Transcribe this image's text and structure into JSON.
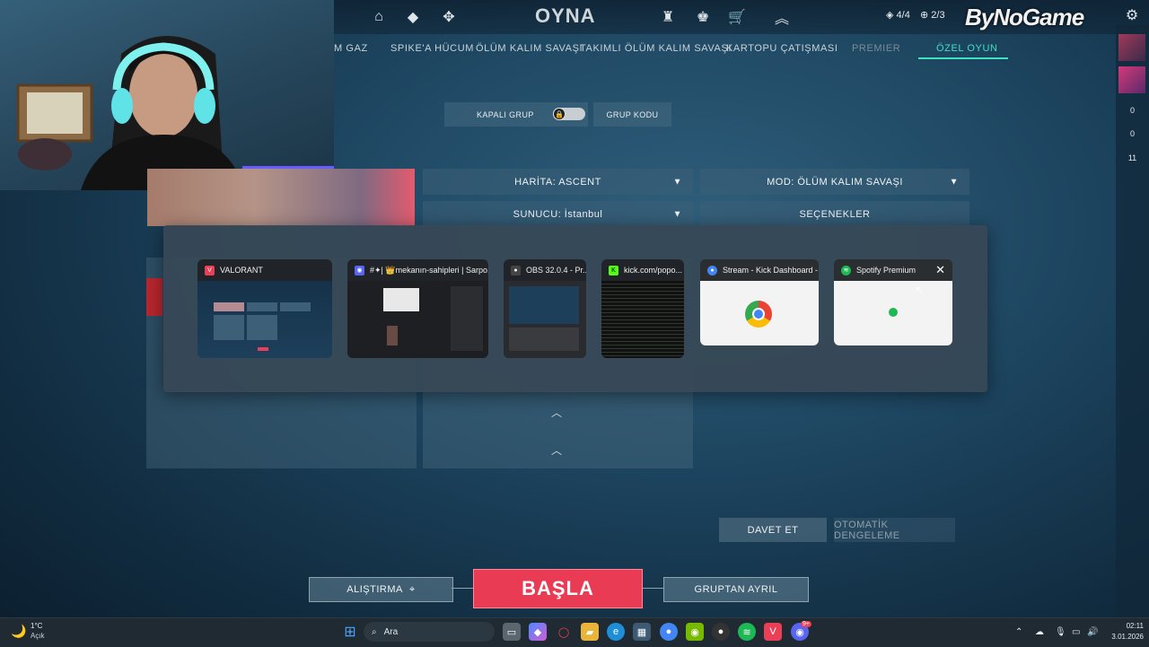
{
  "topnav": {
    "title": "OYNA",
    "left_icons": [
      "home-icon",
      "agents-icon",
      "career-icon"
    ],
    "right_icons": [
      "battlepass-icon",
      "collection-icon",
      "store-icon",
      "rank-icon"
    ],
    "party_count": "4/4",
    "premier_count": "2/3"
  },
  "watermark": "ByNoGame",
  "modes": [
    {
      "label": "M GAZ",
      "state": "normal"
    },
    {
      "label": "SPIKE'A HÜCUM",
      "state": "normal"
    },
    {
      "label": "ÖLÜM KALIM SAVAŞI",
      "state": "normal"
    },
    {
      "label": "TAKIMLI ÖLÜM KALIM SAVAŞI",
      "state": "normal"
    },
    {
      "label": "KARTOPU ÇATIŞMASI",
      "state": "normal"
    },
    {
      "label": "PREMIER",
      "state": "dim"
    },
    {
      "label": "ÖZEL OYUN",
      "state": "active"
    }
  ],
  "lobby": {
    "closed_group": "KAPALI GRUP",
    "group_code": "GRUP KODU",
    "map": "HARİTA: ASCENT",
    "mode": "MOD: ÖLÜM KALIM SAVAŞI",
    "server": "SUNUCU: İstanbul",
    "options": "SEÇENEKLER",
    "invite": "DAVET ET",
    "auto_balance": "OTOMATİK DENGELEME"
  },
  "bottom": {
    "practice": "ALIŞTIRMA",
    "start": "BAŞLA",
    "leave": "GRUPTAN AYRIL"
  },
  "side_numbers": [
    "0",
    "0",
    "11"
  ],
  "task_switcher": [
    {
      "title": "VALORANT",
      "icon": "valorant-icon",
      "color": "#e94057",
      "theme": "dark"
    },
    {
      "title": "#✦| 👑mekanın-sahipleri | Sarpo...",
      "icon": "discord-icon",
      "color": "#5865f2",
      "theme": "dark"
    },
    {
      "title": "OBS 32.0.4 - Pr...",
      "icon": "obs-icon",
      "color": "#333333",
      "theme": "dark"
    },
    {
      "title": "kick.com/popo...",
      "icon": "kick-icon",
      "color": "#53fc18",
      "theme": "dark"
    },
    {
      "title": "Stream - Kick Dashboard - ...",
      "icon": "chrome-icon",
      "color": "#4285f4",
      "theme": "light"
    },
    {
      "title": "Spotify Premium",
      "icon": "spotify-icon",
      "color": "#1db954",
      "theme": "light"
    }
  ],
  "taskbar": {
    "weather_temp": "1°C",
    "weather_desc": "Açık",
    "search_placeholder": "Ara",
    "time": "02:11",
    "date": "3.01.2026",
    "discord_badge": "9+"
  },
  "colors": {
    "accent": "#3fe0c2",
    "start": "#ea3b55"
  }
}
